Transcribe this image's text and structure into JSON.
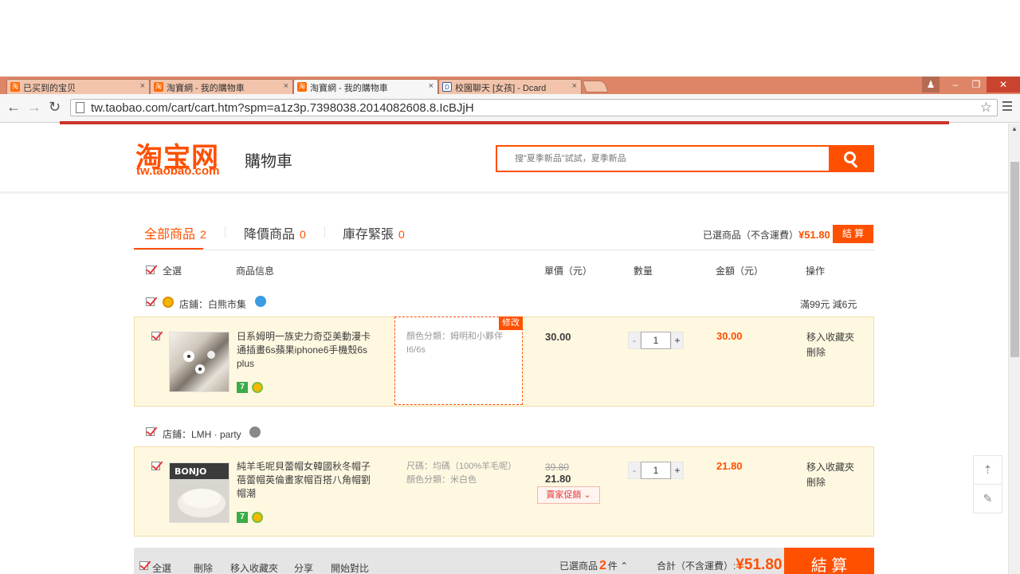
{
  "browser": {
    "tabs": [
      {
        "label": "已买到的宝贝",
        "close": "×"
      },
      {
        "label": "淘寶網 - 我的購物車",
        "close": "×"
      },
      {
        "label": "淘寶網 - 我的購物車",
        "close": "×"
      },
      {
        "label": "校園聊天 [女孩] - Dcard",
        "close": "×"
      }
    ],
    "url": "tw.taobao.com/cart/cart.htm?spm=a1z3p.7398038.2014082608.8.IcBJjH",
    "back": "←",
    "forward": "→",
    "reload": "↻",
    "star": "☆",
    "win_min": "–",
    "win_max": "❐",
    "win_close": "✕",
    "profile": "♟"
  },
  "header": {
    "logo_cn": "淘宝网",
    "logo_en": "tw.taobao.com",
    "cart_title": "購物車",
    "search_placeholder": "搜\"夏季新品\"試試，夏季新品"
  },
  "tabs": [
    {
      "label": "全部商品",
      "count": "2"
    },
    {
      "label": "降價商品",
      "count": "0"
    },
    {
      "label": "庫存緊張",
      "count": "0"
    }
  ],
  "summary_top": {
    "label": "已選商品（不含運費）",
    "price": "¥51.80",
    "checkout": "結 算"
  },
  "columns": {
    "select_all": "全選",
    "info": "商品信息",
    "unit_price": "單價（元）",
    "quantity": "數量",
    "amount": "金額（元）",
    "operation": "操作"
  },
  "shops": [
    {
      "name": "店鋪：白熊市集",
      "promo": "滿99元 減6元",
      "items": [
        {
          "title": "日系姆明一族史力奇亞美動漫卡通插畫6s蘋果iphone6手機殼6s plus",
          "sku": [
            "顏色分類：姆明和小夥伴",
            "I6/6s"
          ],
          "edit": "修改",
          "old_price": "",
          "price": "30.00",
          "qty": "1",
          "sum": "30.00",
          "op_fav": "移入收藏夾",
          "op_del": "刪除"
        }
      ]
    },
    {
      "name": "店鋪：LMH · party",
      "promo": "",
      "items": [
        {
          "title": "純羊毛呢貝蕾帽女韓國秋冬帽子蓓蕾帽英倫畫家帽百搭八角帽劉帽潮",
          "sku": [
            "尺碼：均碼（100%羊毛呢）",
            "顏色分類：米白色"
          ],
          "edit": "",
          "old_price": "39.80",
          "price": "21.80",
          "seller_promo": "賣家促銷 ⌄",
          "qty": "1",
          "sum": "21.80",
          "op_fav": "移入收藏夾",
          "op_del": "刪除"
        }
      ]
    }
  ],
  "bottom": {
    "select_all": "全選",
    "delete": "刪除",
    "move_fav": "移入收藏夾",
    "share": "分享",
    "compare": "開始對比",
    "selected_label": "已選商品",
    "selected_count": "2",
    "selected_unit": "件 ⌃",
    "total_label": "合計（不含運費）:",
    "total": "¥51.80",
    "checkout": "結 算"
  },
  "side_tools": {
    "top": "⇡",
    "edit": "✎"
  },
  "misc": {
    "qty_minus": "-",
    "qty_plus": "+"
  },
  "colors": {
    "accent": "#ff5000",
    "item_bg": "#fff8e1",
    "tab_bar": "#dd8566"
  }
}
